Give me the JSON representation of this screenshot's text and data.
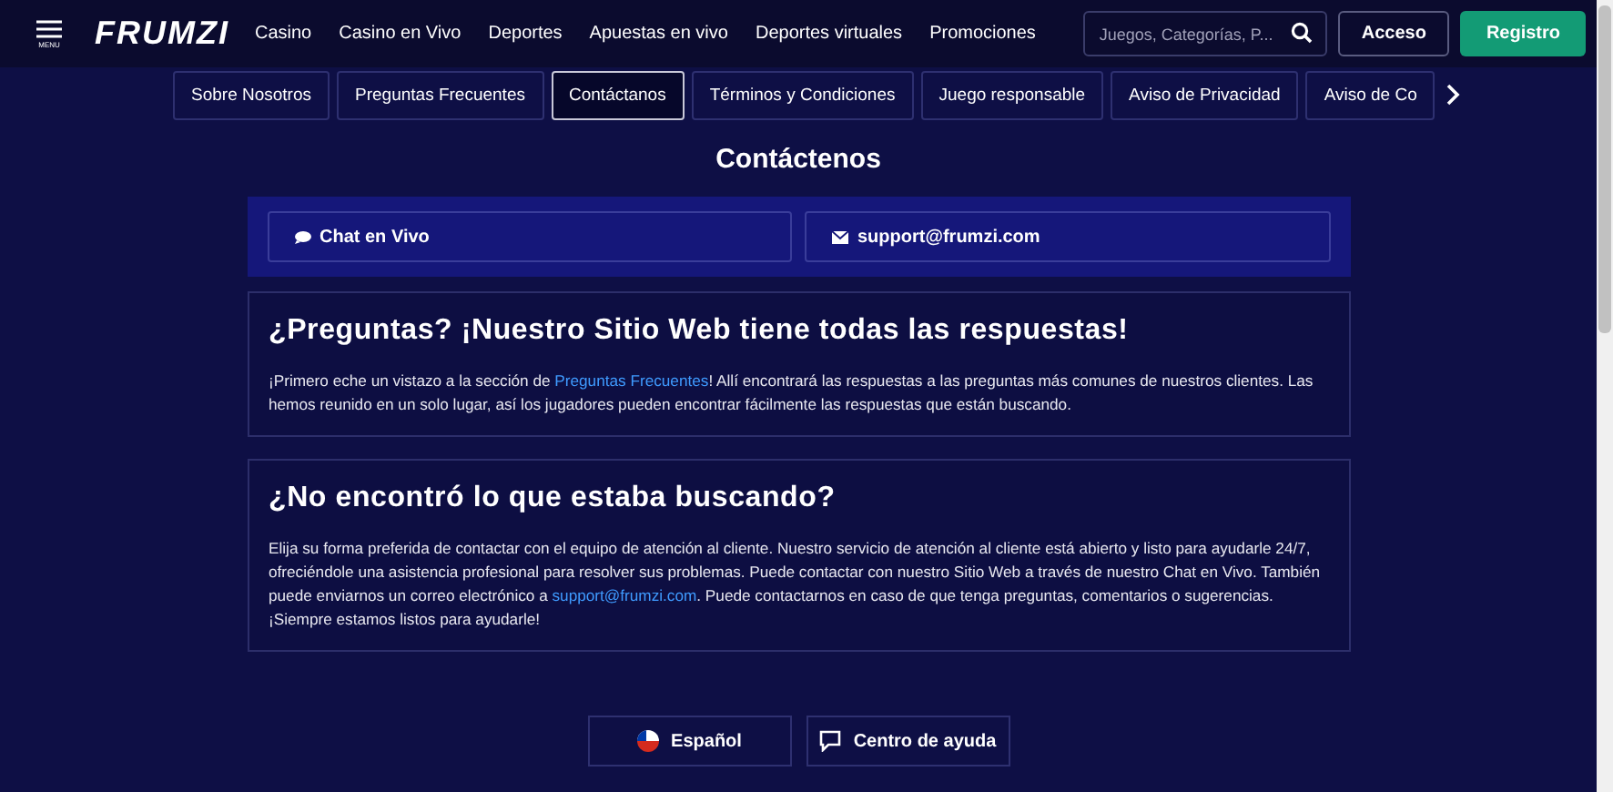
{
  "header": {
    "menu_label": "MENU",
    "logo": "FRUMZI",
    "nav": [
      "Casino",
      "Casino en Vivo",
      "Deportes",
      "Apuestas en vivo",
      "Deportes virtuales",
      "Promociones"
    ],
    "search": {
      "placeholder": "Juegos, Categorías, P..."
    },
    "login": "Acceso",
    "register": "Registro"
  },
  "tabs": [
    {
      "label": "Sobre Nosotros",
      "selected": false
    },
    {
      "label": "Preguntas Frecuentes",
      "selected": false
    },
    {
      "label": "Contáctanos",
      "selected": true
    },
    {
      "label": "Términos y Condiciones",
      "selected": false
    },
    {
      "label": "Juego responsable",
      "selected": false
    },
    {
      "label": "Aviso de Privacidad",
      "selected": false
    },
    {
      "label": "Aviso de Co",
      "selected": false
    }
  ],
  "title": "Contáctenos",
  "contacts": [
    {
      "kind": "chat",
      "label": "Chat en Vivo"
    },
    {
      "kind": "mail",
      "label": "support@frumzi.com"
    }
  ],
  "sections": [
    {
      "heading": "¿Preguntas? ¡Nuestro Sitio Web tiene todas las respuestas!",
      "paragraph": [
        {
          "kind": "text",
          "text": "¡Primero eche un vistazo a la sección de "
        },
        {
          "kind": "link",
          "text": "Preguntas Frecuentes"
        },
        {
          "kind": "text",
          "text": "! Allí encontrará las respuestas a las preguntas más comunes de nuestros clientes. Las hemos reunido en un solo lugar, así los jugadores pueden encontrar fácilmente las respuestas que están buscando."
        }
      ]
    },
    {
      "heading": "¿No encontró lo que estaba buscando?",
      "paragraph": [
        {
          "kind": "text",
          "text": "Elija su forma preferida de contactar con el equipo de atención al cliente. Nuestro servicio de atención al cliente está abierto y listo para ayudarle 24/7, ofreciéndole una asistencia profesional para resolver sus problemas. Puede contactar con nuestro Sitio Web a través de nuestro Chat en Vivo. También puede enviarnos un correo electrónico a "
        },
        {
          "kind": "link",
          "text": "support@frumzi.com"
        },
        {
          "kind": "text",
          "text": ". Puede contactarnos en caso de que tenga preguntas, comentarios o sugerencias. ¡Siempre estamos listos para ayudarle!"
        }
      ]
    }
  ],
  "footer_buttons": [
    {
      "kind": "language",
      "label": "Español"
    },
    {
      "kind": "help",
      "label": "Centro de ayuda"
    }
  ]
}
